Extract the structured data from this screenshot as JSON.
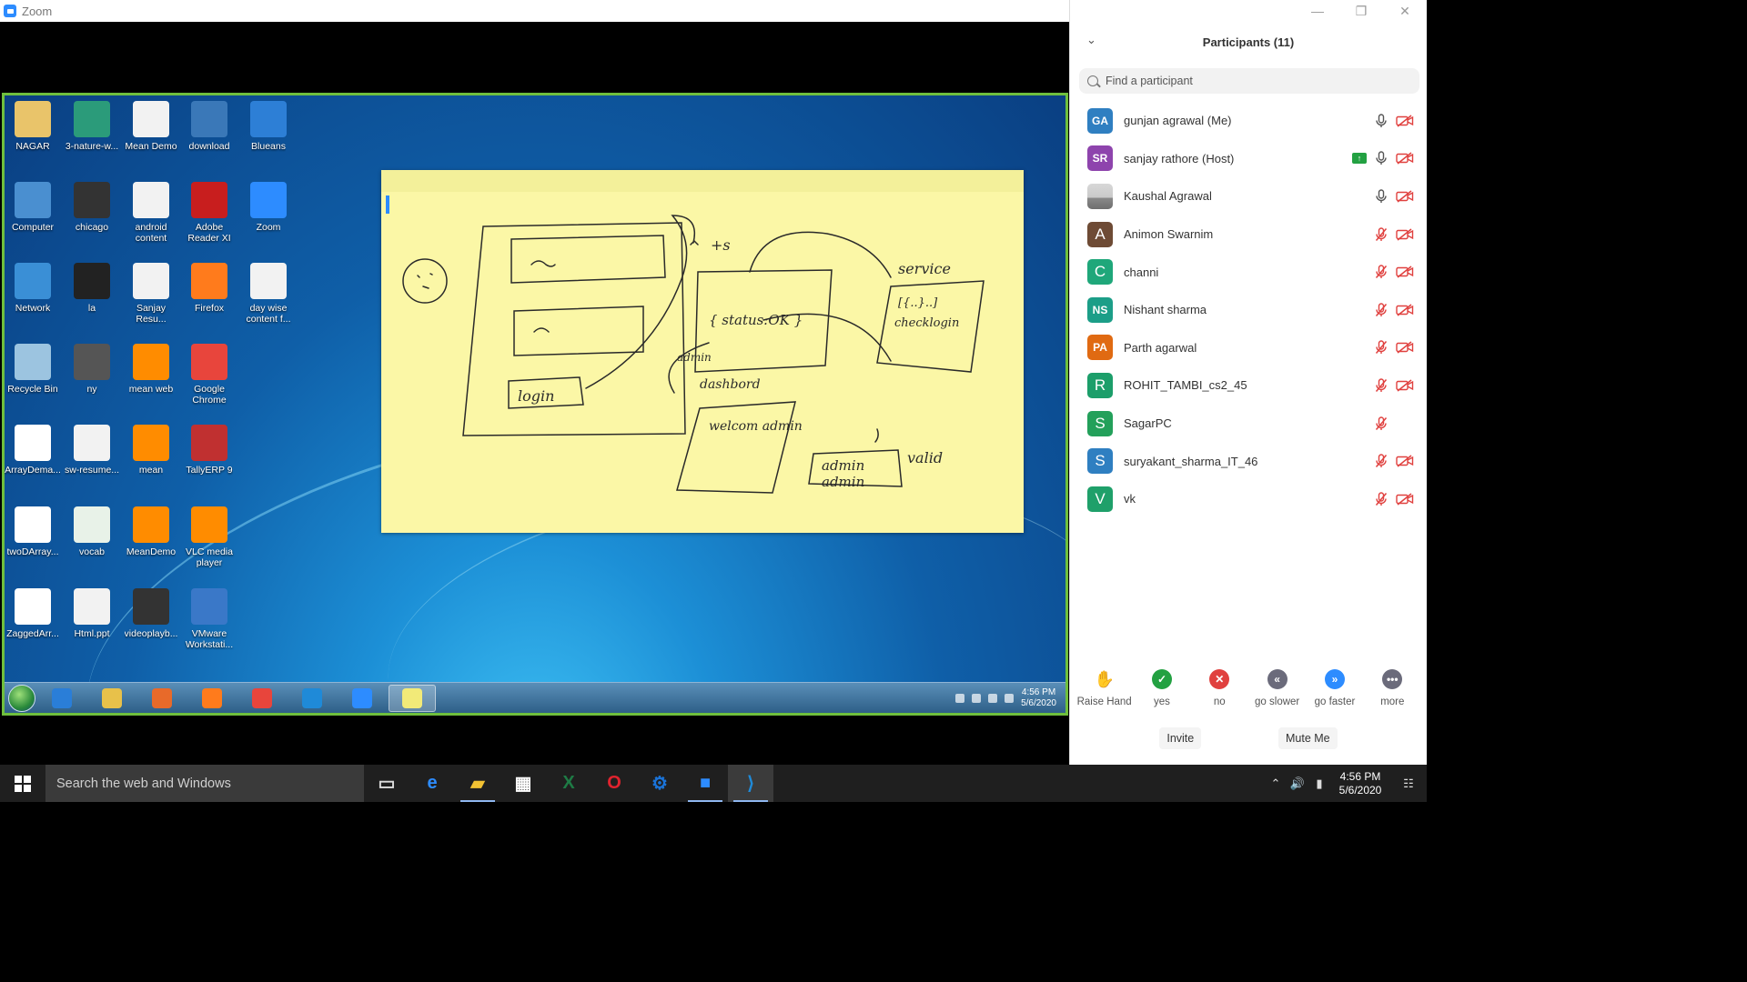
{
  "window": {
    "title": "Zoom"
  },
  "window_controls": {
    "minimize": "—",
    "restore": "❐",
    "close": "✕"
  },
  "desktop_icons": [
    {
      "label": "NAGAR",
      "color": "#e9c46a"
    },
    {
      "label": "3-nature-w...",
      "color": "#2b9b7a"
    },
    {
      "label": "Mean Demo",
      "color": "#f2f2f2"
    },
    {
      "label": "download",
      "color": "#3a78b8"
    },
    {
      "label": "Blueans",
      "color": "#2d7fd6"
    },
    {
      "label": "Computer",
      "color": "#4a8fd0"
    },
    {
      "label": "chicago",
      "color": "#333333"
    },
    {
      "label": "android content",
      "color": "#f2f2f2"
    },
    {
      "label": "Adobe Reader XI",
      "color": "#c81e1e"
    },
    {
      "label": "Zoom",
      "color": "#2d8cff"
    },
    {
      "label": "Network",
      "color": "#3a8fd6"
    },
    {
      "label": "la",
      "color": "#222222"
    },
    {
      "label": "Sanjay Resu...",
      "color": "#f2f2f2"
    },
    {
      "label": "Firefox",
      "color": "#ff7b1c"
    },
    {
      "label": "day wise content f...",
      "color": "#f2f2f2"
    },
    {
      "label": "Recycle Bin",
      "color": "#9cc4e0"
    },
    {
      "label": "ny",
      "color": "#555555"
    },
    {
      "label": "mean web",
      "color": "#ff8c00"
    },
    {
      "label": "Google Chrome",
      "color": "#e8453c"
    },
    {
      "label": "ArrayDema...",
      "color": "#ffffff"
    },
    {
      "label": "sw-resume...",
      "color": "#f2f2f2"
    },
    {
      "label": "mean",
      "color": "#ff8c00"
    },
    {
      "label": "TallyERP 9",
      "color": "#c03030"
    },
    {
      "label": "twoDArray...",
      "color": "#ffffff"
    },
    {
      "label": "vocab",
      "color": "#e8f2e8"
    },
    {
      "label": "MeanDemo",
      "color": "#ff8c00"
    },
    {
      "label": "VLC media player",
      "color": "#ff8c00"
    },
    {
      "label": "ZaggedArr...",
      "color": "#ffffff"
    },
    {
      "label": "Html.ppt",
      "color": "#f2f2f2"
    },
    {
      "label": "videoplayb...",
      "color": "#333333"
    },
    {
      "label": "VMware Workstati...",
      "color": "#3a78c8"
    }
  ],
  "inner_taskbar": {
    "time": "4:56 PM",
    "date": "5/6/2020",
    "apps": [
      {
        "name": "ie",
        "color": "#2a7ed8"
      },
      {
        "name": "explorer",
        "color": "#e8c14a"
      },
      {
        "name": "media",
        "color": "#e86a2a"
      },
      {
        "name": "firefox",
        "color": "#ff7b1c"
      },
      {
        "name": "chrome",
        "color": "#e8453c"
      },
      {
        "name": "vscode",
        "color": "#1f8ad8"
      },
      {
        "name": "zoom",
        "color": "#2d8cff"
      },
      {
        "name": "sticky",
        "color": "#f2ea78"
      }
    ]
  },
  "panel": {
    "title": "Participants (11)",
    "search_placeholder": "Find a participant",
    "participants": [
      {
        "initials": "GA",
        "name": "gunjan agrawal (Me)",
        "color": "#2f7fc1",
        "mic": "on",
        "video": "off",
        "sharing": false
      },
      {
        "initials": "SR",
        "name": "sanjay rathore (Host)",
        "color": "#8e44ad",
        "mic": "on",
        "video": "off",
        "sharing": true
      },
      {
        "initials": "",
        "name": "Kaushal Agrawal",
        "color": "#b9b9b9",
        "mic": "on",
        "video": "off",
        "sharing": false
      },
      {
        "initials": "A",
        "name": "Animon Swarnim",
        "color": "#6e4b35",
        "mic": "muted",
        "video": "off",
        "sharing": false
      },
      {
        "initials": "C",
        "name": "channi",
        "color": "#1fa77a",
        "mic": "muted",
        "video": "off",
        "sharing": false
      },
      {
        "initials": "NS",
        "name": "Nishant sharma",
        "color": "#1c9e88",
        "mic": "muted",
        "video": "off",
        "sharing": false
      },
      {
        "initials": "PA",
        "name": "Parth agarwal",
        "color": "#e06a12",
        "mic": "muted",
        "video": "off",
        "sharing": false
      },
      {
        "initials": "R",
        "name": "ROHIT_TAMBI_cs2_45",
        "color": "#1c9e6a",
        "mic": "muted",
        "video": "off",
        "sharing": false
      },
      {
        "initials": "S",
        "name": "SagarPC",
        "color": "#23a05a",
        "mic": "muted",
        "video": "none",
        "sharing": false
      },
      {
        "initials": "S",
        "name": "suryakant_sharma_IT_46",
        "color": "#2f7fc1",
        "mic": "muted",
        "video": "off",
        "sharing": false
      },
      {
        "initials": "V",
        "name": "vk",
        "color": "#1fa06a",
        "mic": "muted",
        "video": "off",
        "sharing": false
      }
    ],
    "reactions": [
      {
        "label": "Raise Hand",
        "glyph": "✋",
        "color": "#2d8cff"
      },
      {
        "label": "yes",
        "glyph": "✓",
        "color": "#23a142"
      },
      {
        "label": "no",
        "glyph": "✕",
        "color": "#e0413f"
      },
      {
        "label": "go slower",
        "glyph": "«",
        "color": "#6b6b7b"
      },
      {
        "label": "go faster",
        "glyph": "»",
        "color": "#2d8cff"
      },
      {
        "label": "more",
        "glyph": "•••",
        "color": "#6b6b7b"
      }
    ],
    "buttons": {
      "invite": "Invite",
      "mute": "Mute Me"
    }
  },
  "host_taskbar": {
    "search_placeholder": "Search the web and Windows",
    "time": "4:56 PM",
    "date": "5/6/2020",
    "apps": [
      {
        "name": "task-view",
        "glyph": "▭",
        "color": "#dddddd",
        "running": false
      },
      {
        "name": "edge",
        "glyph": "e",
        "color": "#2d8cff",
        "running": false
      },
      {
        "name": "file-explorer",
        "glyph": "▰",
        "color": "#f2c233",
        "running": true
      },
      {
        "name": "store",
        "glyph": "▦",
        "color": "#ffffff",
        "running": false
      },
      {
        "name": "excel",
        "glyph": "X",
        "color": "#1e7b45",
        "running": false
      },
      {
        "name": "opera",
        "glyph": "O",
        "color": "#e0232e",
        "running": false
      },
      {
        "name": "settings",
        "glyph": "⚙",
        "color": "#1a73d8",
        "running": false
      },
      {
        "name": "zoom",
        "glyph": "■",
        "color": "#2d8cff",
        "running": true
      },
      {
        "name": "vscode",
        "glyph": "⟩",
        "color": "#1f8ad8",
        "running": true
      }
    ]
  }
}
